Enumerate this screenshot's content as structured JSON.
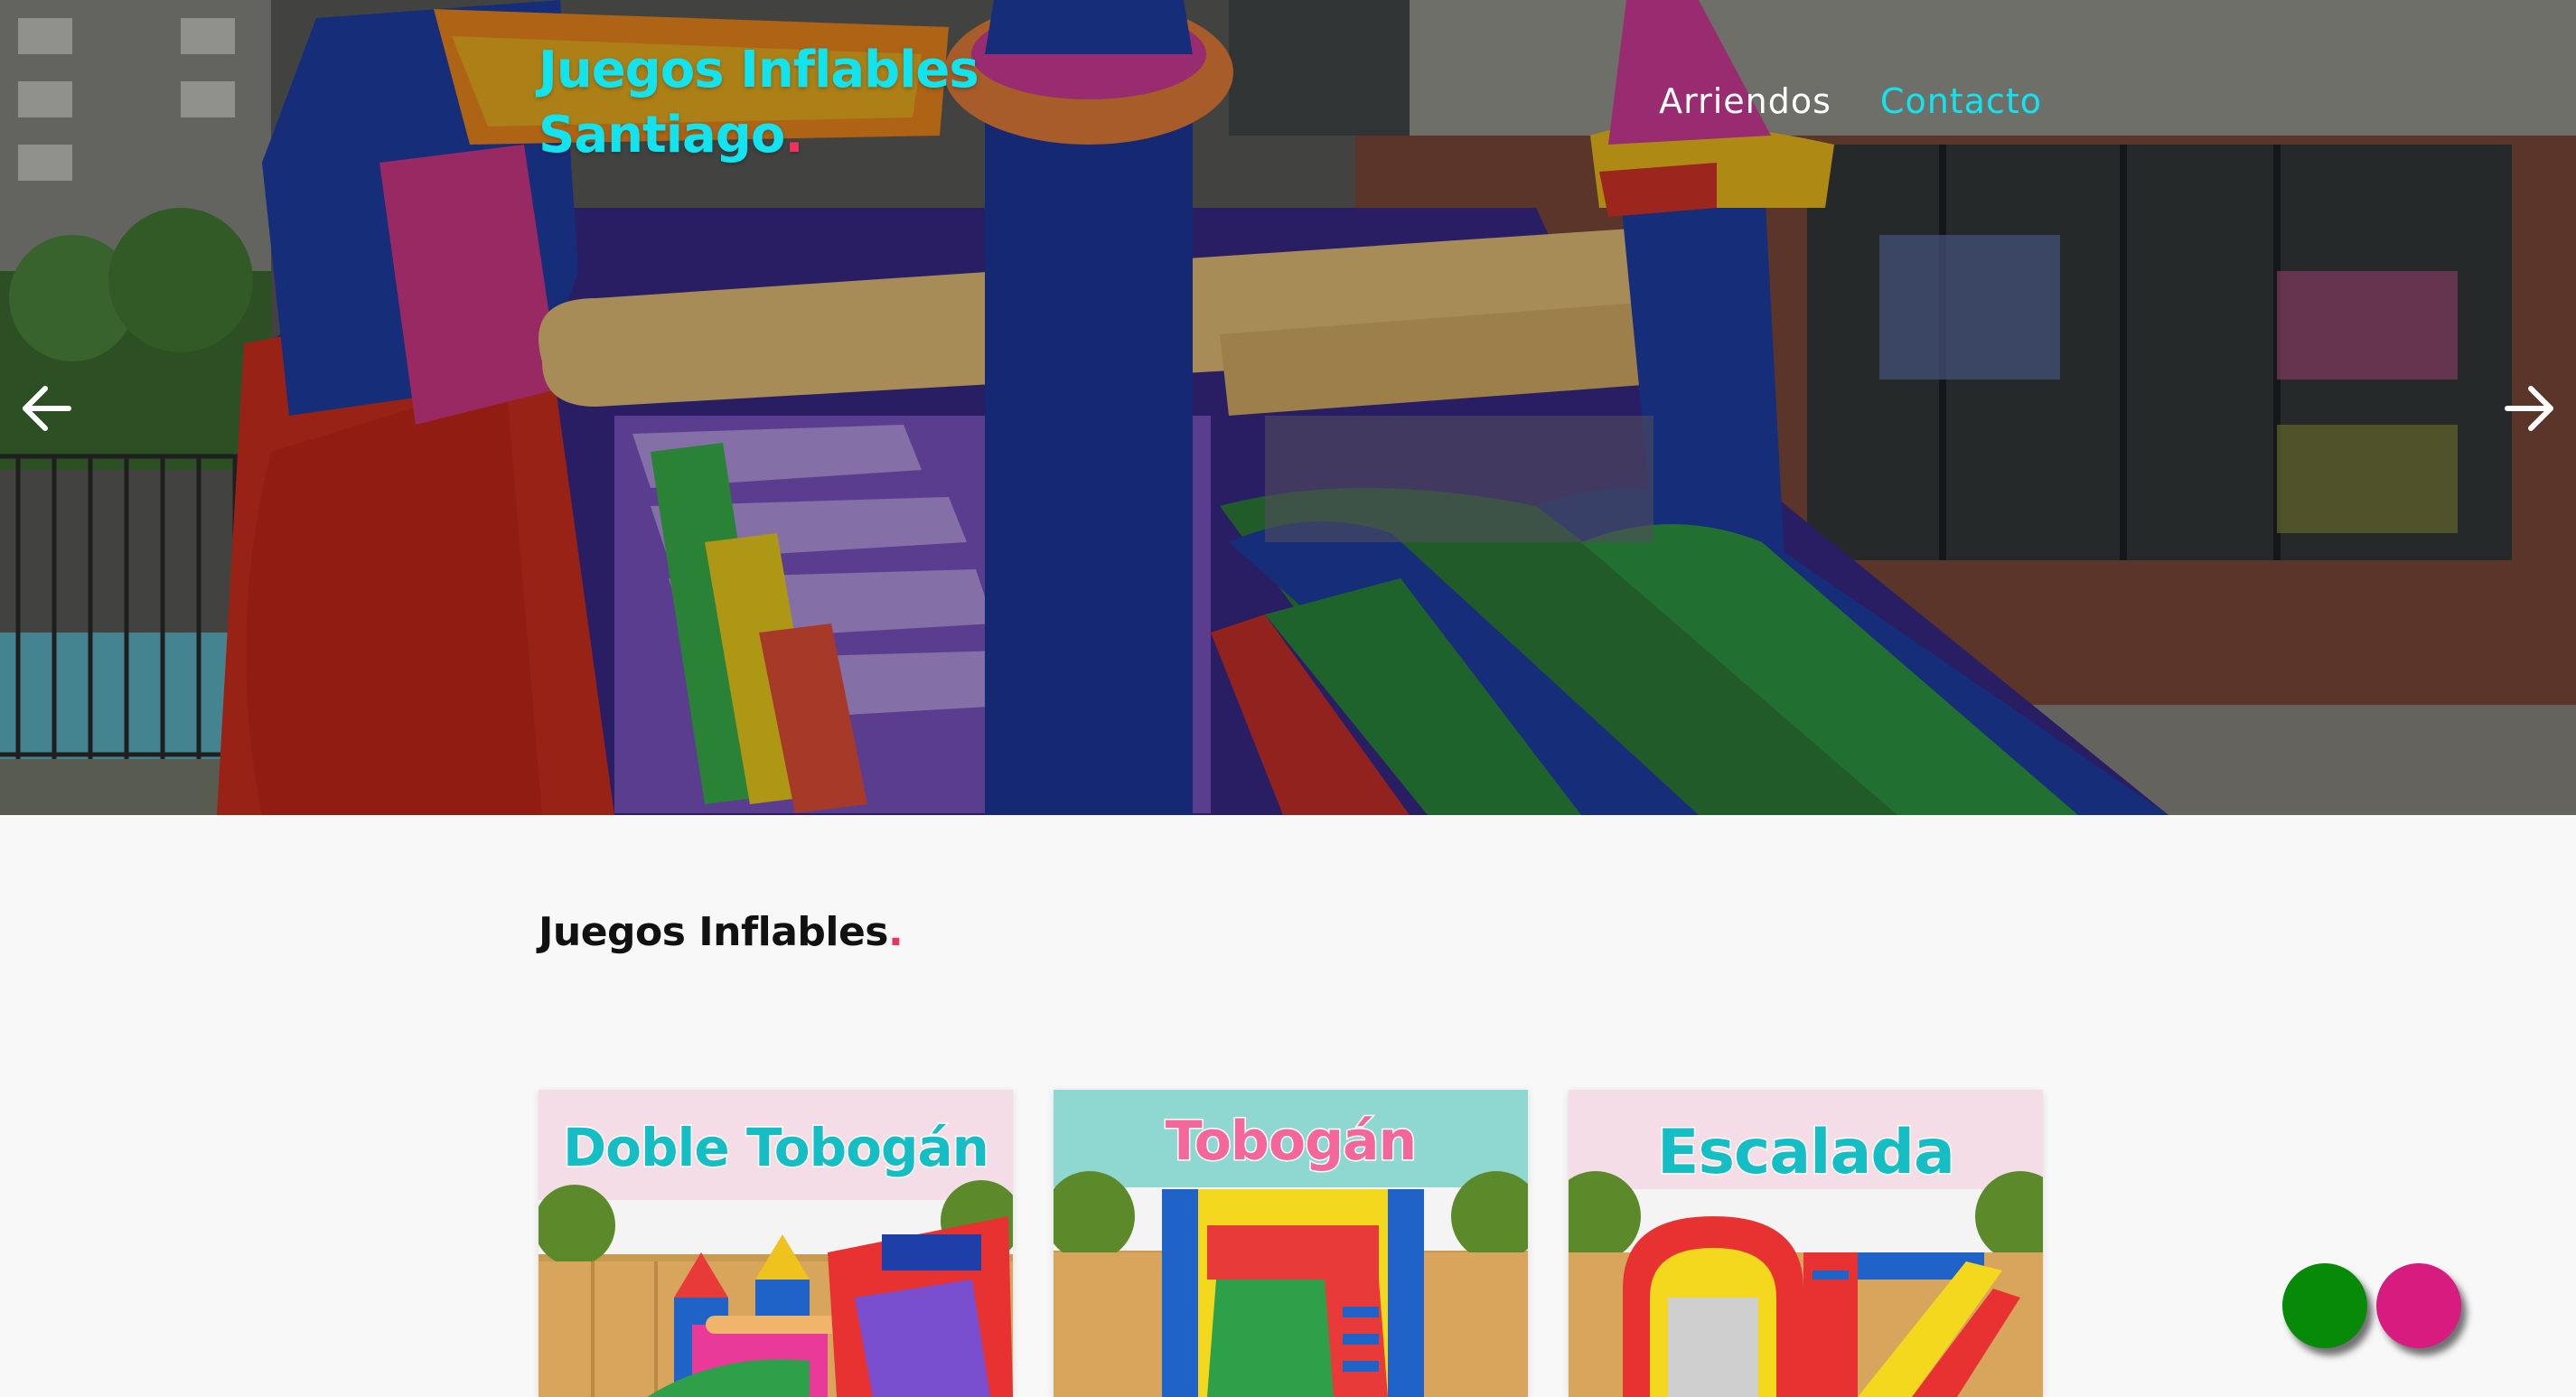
{
  "header": {
    "brand_line1": "Juegos Inflables",
    "brand_line2": "Santiago",
    "brand_dot": ".",
    "nav": [
      {
        "label": "Arriendos"
      },
      {
        "label": "Contacto"
      }
    ]
  },
  "hero": {
    "prev_icon": "arrow-left-icon",
    "next_icon": "arrow-right-icon"
  },
  "main": {
    "section_title": "Juegos Inflables",
    "section_dot": ".",
    "cards": [
      {
        "title": "Doble Tobogán"
      },
      {
        "title": "Tobogán"
      },
      {
        "title": "Escalada"
      }
    ]
  },
  "floating": {
    "green_color": "#078a07",
    "pink_color": "#d81b7f"
  },
  "colors": {
    "brand": "#11e4ef",
    "accent_red": "#f0325a",
    "background": "#f8f8f8"
  }
}
